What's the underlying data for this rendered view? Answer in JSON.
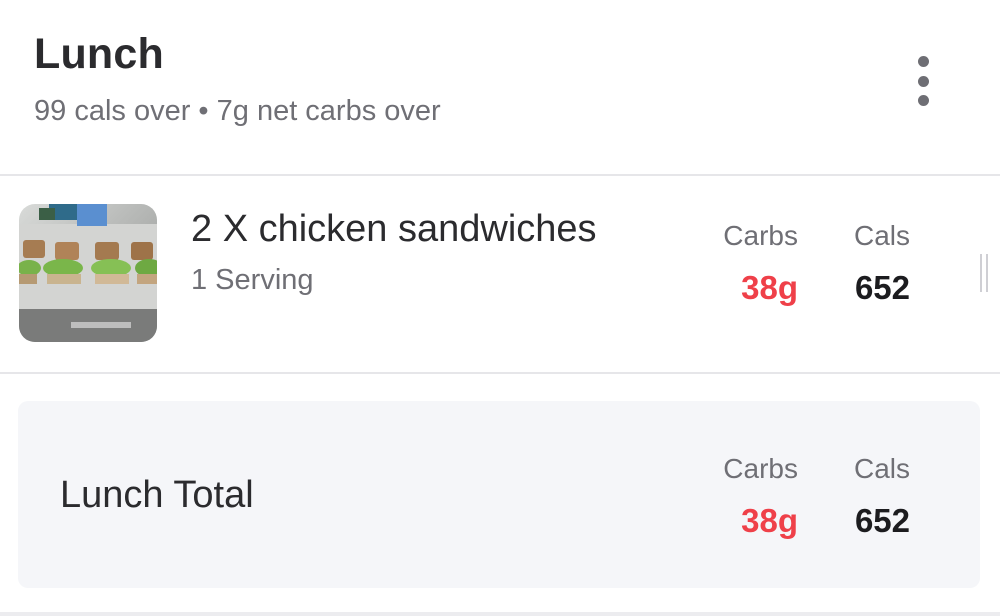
{
  "meal": {
    "title": "Lunch",
    "summary": "99 cals over • 7g net carbs over"
  },
  "food_items": [
    {
      "name": "2 X chicken sandwiches",
      "serving": "1 Serving",
      "carbs_label": "Carbs",
      "carbs_value": "38g",
      "cals_label": "Cals",
      "cals_value": "652"
    }
  ],
  "total": {
    "label": "Lunch Total",
    "carbs_label": "Carbs",
    "carbs_value": "38g",
    "cals_label": "Cals",
    "cals_value": "652"
  },
  "colors": {
    "over_value": "#ef4049",
    "normal_value": "#1c1c1f",
    "muted_text": "#6f6f75",
    "total_background": "#f5f6f9"
  },
  "icons": {
    "menu": "kebab-menu-icon",
    "drag": "drag-handle-icon"
  }
}
